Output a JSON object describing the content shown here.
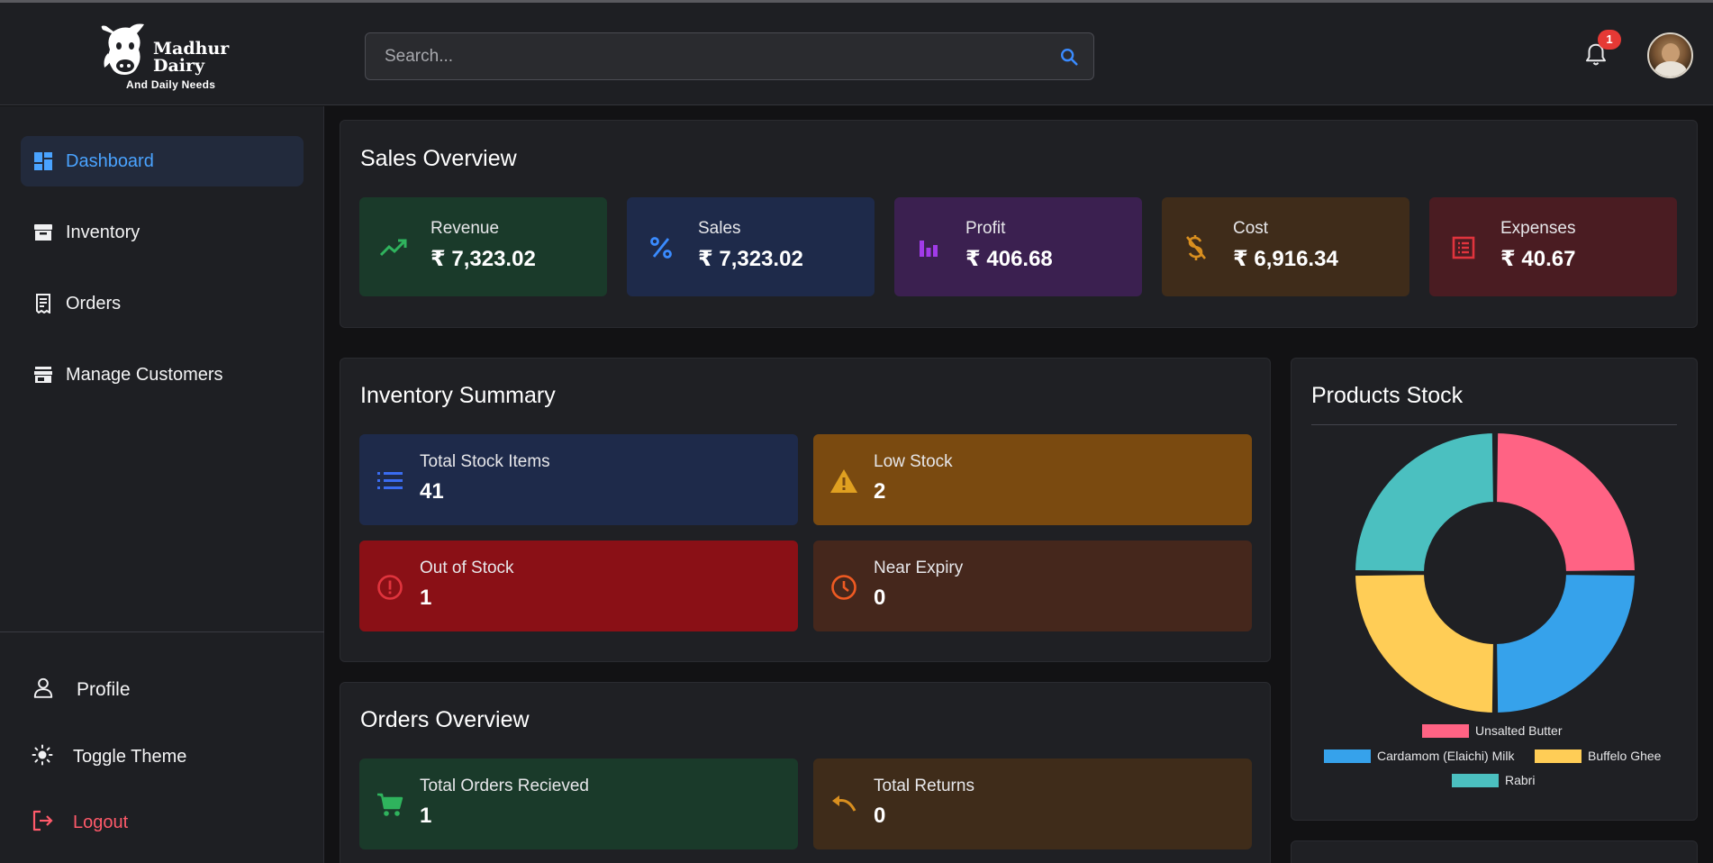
{
  "brand": {
    "name_line1": "Madhur",
    "name_line2": "Dairy",
    "tagline": "And Daily Needs"
  },
  "header": {
    "search_placeholder": "Search...",
    "notification_count": "1",
    "icons": {
      "search": "search-icon",
      "notifications": "bell-icon",
      "avatar": "user-avatar"
    }
  },
  "sidebar": {
    "items": [
      {
        "label": "Dashboard",
        "icon": "dashboard-icon",
        "active": true
      },
      {
        "label": "Inventory",
        "icon": "archive-icon",
        "active": false
      },
      {
        "label": "Orders",
        "icon": "receipt-icon",
        "active": false
      },
      {
        "label": "Manage Customers",
        "icon": "store-icon",
        "active": false
      }
    ],
    "bottom": {
      "profile": "Profile",
      "toggle_theme": "Toggle Theme",
      "logout": "Logout"
    }
  },
  "sales_overview": {
    "title": "Sales Overview",
    "tiles": [
      {
        "label": "Revenue",
        "value": "₹ 7,323.02",
        "icon": "trending-up-icon",
        "bg": "#1a3a2a",
        "accent": "#2fb35d"
      },
      {
        "label": "Sales",
        "value": "₹ 7,323.02",
        "icon": "percent-icon",
        "bg": "#1e2a4a",
        "accent": "#3a8bff"
      },
      {
        "label": "Profit",
        "value": "₹ 406.68",
        "icon": "bar-chart-icon",
        "bg": "#3b2050",
        "accent": "#a13be8"
      },
      {
        "label": "Cost",
        "value": "₹ 6,916.34",
        "icon": "money-off-icon",
        "bg": "#3f2c1a",
        "accent": "#d98f1f"
      },
      {
        "label": "Expenses",
        "value": "₹ 40.67",
        "icon": "receipt-long-icon",
        "bg": "#4a1c22",
        "accent": "#e0343d"
      }
    ]
  },
  "inventory_summary": {
    "title": "Inventory Summary",
    "tiles": [
      {
        "label": "Total Stock Items",
        "value": "41",
        "icon": "list-icon",
        "bg": "#1e2a4a",
        "accent": "#3a6cf0"
      },
      {
        "label": "Low Stock",
        "value": "2",
        "icon": "warning-icon",
        "bg": "#7a4a10",
        "accent": "#e0a020"
      },
      {
        "label": "Out of Stock",
        "value": "1",
        "icon": "error-icon",
        "bg": "#8a1016",
        "accent": "#e0343d"
      },
      {
        "label": "Near Expiry",
        "value": "0",
        "icon": "clock-icon",
        "bg": "#45271c",
        "accent": "#ef5a22"
      }
    ]
  },
  "orders_overview": {
    "title": "Orders Overview",
    "tiles": [
      {
        "label": "Total Orders Recieved",
        "value": "1",
        "icon": "cart-icon",
        "bg": "#1a3a2a",
        "accent": "#2fb35d"
      },
      {
        "label": "Total Returns",
        "value": "0",
        "icon": "undo-icon",
        "bg": "#3f2c1a",
        "accent": "#d98f1f"
      }
    ]
  },
  "products_stock": {
    "title": "Products Stock"
  },
  "chart_data": {
    "type": "pie",
    "variant": "doughnut",
    "categories": [
      "Unsalted Butter",
      "Cardamom (Elaichi) Milk",
      "Buffelo Ghee",
      "Rabri"
    ],
    "values": [
      1,
      1,
      1,
      1
    ],
    "colors": [
      "#ff6384",
      "#36a2eb",
      "#ffcd56",
      "#4bc0c0"
    ],
    "legend_position": "bottom"
  }
}
